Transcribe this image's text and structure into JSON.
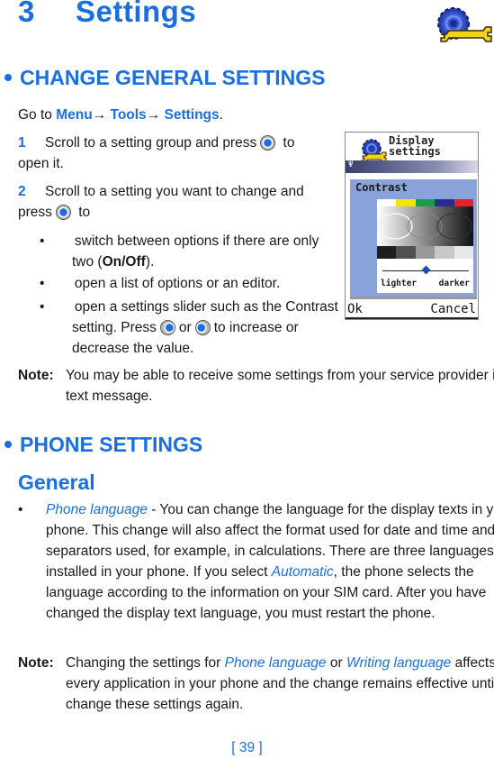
{
  "header": {
    "chapter_number": "3",
    "chapter_title": "Settings",
    "icon": "settings-gear-wrench-icon"
  },
  "section1": {
    "heading": "CHANGE GENERAL SETTINGS",
    "intro_prefix": "Go to ",
    "path": [
      "Menu",
      "Tools",
      "Settings"
    ],
    "path_separator": "→",
    "intro_suffix": ".",
    "steps": [
      {
        "number": "1",
        "text_before": "Scroll to a setting group and press",
        "text_after": "to open it.",
        "key_icon": "navi-scroll-key-icon"
      },
      {
        "number": "2",
        "text_before": "Scroll to a setting you want to change and press",
        "text_after": "to",
        "key_icon": "navi-scroll-key-icon"
      }
    ],
    "bullets": [
      {
        "text_before": "switch between options if there are only two (",
        "bold": "On/Off",
        "text_after": ")."
      },
      {
        "text": "open a list of options or an editor."
      },
      {
        "text_before": "open a settings slider such as the Contrast setting. Press",
        "middle": "or",
        "text_after": "to increase or decrease the value."
      }
    ],
    "note": {
      "label": "Note:",
      "text": "You may be able to receive some settings from your service provider in a text message."
    }
  },
  "phone_screen": {
    "title_line1": "Display",
    "title_line2": "settings",
    "panel_title": "Contrast",
    "swatch_colors": [
      "#ffffff",
      "#f2e600",
      "#12a04a",
      "#2a2d8e",
      "#e8202a"
    ],
    "gray_steps": [
      "#1e1e1e",
      "#505050",
      "#989898",
      "#c8c8c8",
      "#e8e8e8"
    ],
    "slider_value_fraction": 0.5,
    "slider_left_label": "lighter",
    "slider_right_label": "darker",
    "left_softkey": "Ok",
    "right_softkey": "Cancel"
  },
  "section2": {
    "heading": "PHONE SETTINGS",
    "subheading": "General",
    "item": {
      "term": "Phone language",
      "text": " - You can change the language for the display texts in your phone. This change will also affect the format used for date and time and the separators used, for example, in calculations. There are three languages installed in your phone. If you select ",
      "term2": "Automatic",
      "text2": ", the phone selects the language according to the information on your SIM card. After you have changed the display text language, you must restart the phone."
    },
    "note": {
      "label": "Note:",
      "text_before": "Changing the settings for ",
      "term1": "Phone language",
      "middle": " or ",
      "term2": "Writing language",
      "text_after": " affects every application in your phone and the change remains effective until you change these settings again."
    }
  },
  "footer": {
    "page_number": "[ 39 ]"
  }
}
